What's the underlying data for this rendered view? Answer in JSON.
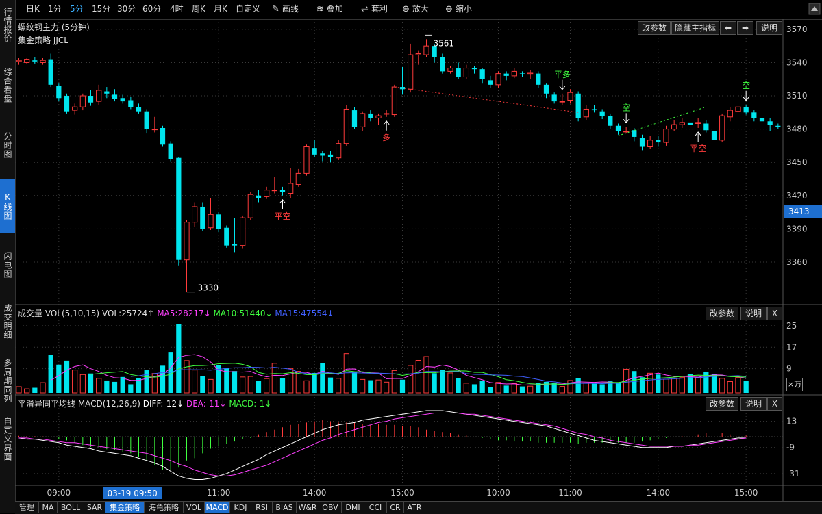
{
  "toolbar": {
    "periods": [
      "日K",
      "1分",
      "5分",
      "15分",
      "30分",
      "60分",
      "4时",
      "周K",
      "月K",
      "自定义"
    ],
    "active_period": "5分",
    "tools": [
      {
        "icon": "pencil-icon",
        "label": "画线"
      },
      {
        "icon": "layers-icon",
        "label": "叠加"
      },
      {
        "icon": "arbitrage-icon",
        "label": "套利"
      },
      {
        "icon": "zoom-in-icon",
        "label": "放大"
      },
      {
        "icon": "zoom-out-icon",
        "label": "缩小"
      }
    ]
  },
  "sidebar": {
    "items": [
      {
        "label": "行情报价",
        "active": false
      },
      {
        "label": "综合看盘",
        "active": false
      },
      {
        "label": "分时图",
        "active": false
      },
      {
        "label": "K线图",
        "active": true
      },
      {
        "label": "闪电图",
        "active": false
      },
      {
        "label": "成交明细",
        "active": false
      },
      {
        "label": "多周期同列",
        "active": false
      },
      {
        "label": "自定义界面",
        "active": false
      }
    ]
  },
  "main_chart": {
    "title": "螺纹钢主力 (5分钟)",
    "strategy": "集金策略 JJCL",
    "buttons": [
      "改参数",
      "隐藏主指标",
      "说明"
    ],
    "current_price": "3413",
    "high_label": "3561",
    "low_label": "3330",
    "signals": [
      {
        "text": "平空",
        "idx": 33,
        "dir": "up"
      },
      {
        "text": "多",
        "idx": 46,
        "dir": "up"
      },
      {
        "text": "平多",
        "idx": 68,
        "dir": "down"
      },
      {
        "text": "空",
        "idx": 76,
        "dir": "down"
      },
      {
        "text": "平空",
        "idx": 85,
        "dir": "up"
      },
      {
        "text": "空",
        "idx": 91,
        "dir": "down"
      }
    ]
  },
  "vol_panel": {
    "label": "成交量 VOL(5,10,15)",
    "vol": "VOL:25724↑",
    "ma5": "MA5:28217↓",
    "ma10": "MA10:51440↓",
    "ma15": "MA15:47554↓",
    "buttons": [
      "改参数",
      "说明",
      "X"
    ],
    "unit": "×万"
  },
  "macd_panel": {
    "label": "平滑异同平均线 MACD(12,26,9)",
    "diff": "DIFF:-12↓",
    "dea": "DEA:-11↓",
    "macd": "MACD:-1↓",
    "buttons": [
      "改参数",
      "说明",
      "X"
    ]
  },
  "time_axis": {
    "labels": [
      {
        "text": "09:00",
        "idx": 5
      },
      {
        "text": "11:00",
        "idx": 25
      },
      {
        "text": "14:00",
        "idx": 37
      },
      {
        "text": "15:00",
        "idx": 48
      },
      {
        "text": "10:00",
        "idx": 60
      },
      {
        "text": "11:00",
        "idx": 69
      },
      {
        "text": "14:00",
        "idx": 80
      },
      {
        "text": "15:00",
        "idx": 91
      }
    ],
    "cursor_label": "03-19 09:50",
    "cursor_idx": 13
  },
  "bottom_tabs": [
    "管理",
    "MA",
    "BOLL",
    "SAR",
    "集金策略",
    "海龟策略",
    "VOL",
    "MACD",
    "KDJ",
    "RSI",
    "BIAS",
    "W&R",
    "OBV",
    "DMI",
    "CCI",
    "CR",
    "ATR"
  ],
  "active_bottom_tabs": [
    "集金策略",
    "MACD"
  ],
  "colors": {
    "up": "#ff3b3b",
    "down": "#00e5ee",
    "accent": "#1e6fd0",
    "ma5": "#ff40ff",
    "ma10": "#40ff40",
    "ma15": "#4060ff",
    "diff": "#ffffff",
    "dea": "#ff40ff"
  },
  "chart_data": {
    "type": "candlestick",
    "price_axis": {
      "ticks": [
        3570,
        3540,
        3510,
        3480,
        3450,
        3420,
        3390,
        3360
      ],
      "range": [
        3326,
        3573
      ]
    },
    "vol_axis": {
      "ticks": [
        25,
        17,
        9
      ],
      "range": [
        0,
        27
      ]
    },
    "macd_axis": {
      "ticks": [
        13,
        -9,
        -31
      ],
      "range": [
        -38,
        22
      ]
    },
    "candles": [
      [
        3541,
        3542,
        3538,
        3544
      ],
      [
        3540,
        3543,
        3539,
        3544
      ],
      [
        3542,
        3541,
        3539,
        3545
      ],
      [
        3540,
        3542,
        3538,
        3544
      ],
      [
        3543,
        3520,
        3518,
        3548
      ],
      [
        3519,
        3508,
        3505,
        3521
      ],
      [
        3510,
        3496,
        3494,
        3512
      ],
      [
        3497,
        3500,
        3493,
        3503
      ],
      [
        3500,
        3510,
        3497,
        3512
      ],
      [
        3510,
        3504,
        3501,
        3515
      ],
      [
        3505,
        3515,
        3502,
        3520
      ],
      [
        3514,
        3512,
        3508,
        3518
      ],
      [
        3511,
        3507,
        3505,
        3516
      ],
      [
        3508,
        3505,
        3503,
        3511
      ],
      [
        3506,
        3500,
        3498,
        3509
      ],
      [
        3500,
        3496,
        3494,
        3503
      ],
      [
        3496,
        3480,
        3476,
        3498
      ],
      [
        3480,
        3480,
        3477,
        3491
      ],
      [
        3481,
        3466,
        3464,
        3483
      ],
      [
        3467,
        3453,
        3451,
        3469
      ],
      [
        3454,
        3362,
        3357,
        3455
      ],
      [
        3362,
        3396,
        3333,
        3398
      ],
      [
        3396,
        3410,
        3392,
        3414
      ],
      [
        3410,
        3390,
        3388,
        3414
      ],
      [
        3391,
        3403,
        3389,
        3418
      ],
      [
        3403,
        3390,
        3387,
        3405
      ],
      [
        3391,
        3375,
        3373,
        3393
      ],
      [
        3376,
        3375,
        3369,
        3400
      ],
      [
        3375,
        3400,
        3372,
        3402
      ],
      [
        3400,
        3421,
        3398,
        3423
      ],
      [
        3420,
        3418,
        3414,
        3425
      ],
      [
        3419,
        3425,
        3417,
        3428
      ],
      [
        3425,
        3425,
        3422,
        3437
      ],
      [
        3425,
        3423,
        3420,
        3428
      ],
      [
        3422,
        3431,
        3418,
        3445
      ],
      [
        3430,
        3440,
        3428,
        3444
      ],
      [
        3440,
        3464,
        3438,
        3466
      ],
      [
        3463,
        3457,
        3455,
        3470
      ],
      [
        3458,
        3456,
        3451,
        3460
      ],
      [
        3457,
        3455,
        3450,
        3460
      ],
      [
        3454,
        3467,
        3452,
        3470
      ],
      [
        3467,
        3498,
        3465,
        3502
      ],
      [
        3497,
        3482,
        3480,
        3500
      ],
      [
        3482,
        3494,
        3478,
        3496
      ],
      [
        3494,
        3490,
        3487,
        3497
      ],
      [
        3490,
        3492,
        3484,
        3494
      ],
      [
        3494,
        3494,
        3491,
        3497
      ],
      [
        3493,
        3518,
        3491,
        3520
      ],
      [
        3518,
        3516,
        3511,
        3536
      ],
      [
        3516,
        3547,
        3513,
        3557
      ],
      [
        3547,
        3548,
        3538,
        3551
      ],
      [
        3547,
        3555,
        3545,
        3561
      ],
      [
        3555,
        3545,
        3540,
        3557
      ],
      [
        3545,
        3532,
        3530,
        3548
      ],
      [
        3532,
        3535,
        3530,
        3537
      ],
      [
        3535,
        3527,
        3525,
        3540
      ],
      [
        3527,
        3535,
        3525,
        3538
      ],
      [
        3535,
        3534,
        3530,
        3537
      ],
      [
        3534,
        3525,
        3521,
        3535
      ],
      [
        3524,
        3520,
        3517,
        3528
      ],
      [
        3520,
        3530,
        3517,
        3532
      ],
      [
        3530,
        3528,
        3524,
        3532
      ],
      [
        3528,
        3532,
        3526,
        3535
      ],
      [
        3531,
        3530,
        3527,
        3532
      ],
      [
        3530,
        3531,
        3525,
        3533
      ],
      [
        3530,
        3520,
        3517,
        3532
      ],
      [
        3520,
        3512,
        3508,
        3521
      ],
      [
        3511,
        3505,
        3503,
        3513
      ],
      [
        3505,
        3505,
        3502,
        3512
      ],
      [
        3506,
        3513,
        3503,
        3516
      ],
      [
        3512,
        3490,
        3487,
        3514
      ],
      [
        3491,
        3498,
        3488,
        3502
      ],
      [
        3498,
        3497,
        3495,
        3502
      ],
      [
        3496,
        3492,
        3489,
        3498
      ],
      [
        3492,
        3483,
        3480,
        3494
      ],
      [
        3483,
        3478,
        3475,
        3485
      ],
      [
        3478,
        3478,
        3476,
        3482
      ],
      [
        3479,
        3473,
        3469,
        3481
      ],
      [
        3472,
        3464,
        3461,
        3475
      ],
      [
        3464,
        3470,
        3462,
        3474
      ],
      [
        3470,
        3468,
        3464,
        3474
      ],
      [
        3468,
        3480,
        3465,
        3483
      ],
      [
        3480,
        3484,
        3478,
        3488
      ],
      [
        3484,
        3486,
        3481,
        3490
      ],
      [
        3486,
        3484,
        3481,
        3488
      ],
      [
        3485,
        3486,
        3481,
        3490
      ],
      [
        3485,
        3479,
        3477,
        3488
      ],
      [
        3478,
        3470,
        3468,
        3481
      ],
      [
        3470,
        3492,
        3468,
        3494
      ],
      [
        3491,
        3497,
        3487,
        3500
      ],
      [
        3496,
        3500,
        3492,
        3503
      ],
      [
        3500,
        3495,
        3493,
        3502
      ],
      [
        3495,
        3490,
        3487,
        3497
      ],
      [
        3490,
        3487,
        3485,
        3492
      ],
      [
        3487,
        3484,
        3478,
        3490
      ],
      [
        3483,
        3482,
        3480,
        3485
      ]
    ],
    "volumes": [
      2.3,
      1.5,
      1.9,
      3.8,
      14.2,
      10.5,
      12.0,
      8.5,
      6.8,
      7.2,
      5.4,
      4.6,
      4.1,
      5.9,
      3.2,
      5.5,
      8.4,
      7.2,
      10.1,
      15.0,
      25.5,
      12.0,
      8.5,
      6.3,
      5.0,
      10.4,
      9.3,
      8.1,
      5.9,
      6.1,
      4.4,
      5.3,
      11.0,
      5.4,
      9.1,
      8.0,
      4.5,
      7.4,
      11.2,
      5.7,
      5.4,
      14.6,
      7.7,
      5.0,
      4.7,
      4.8,
      4.0,
      8.3,
      4.9,
      10.2,
      12.1,
      13.5,
      7.3,
      8.6,
      7.4,
      5.6,
      3.6,
      3.2,
      4.6,
      2.2,
      3.9,
      2.7,
      3.5,
      2.4,
      2.5,
      3.7,
      4.1,
      3.8,
      2.4,
      4.6,
      5.6,
      3.6,
      3.4,
      3.2,
      4.3,
      3.6,
      8.8,
      8.1,
      5.8,
      7.3,
      6.8,
      5.1,
      5.5,
      5.8,
      6.9,
      5.8,
      7.9,
      7.1,
      5.4,
      4.2,
      5.7,
      4.4
    ],
    "macd_bars": [
      0.8,
      0.6,
      0.4,
      0.2,
      -0.5,
      -1.8,
      -3.0,
      -5.0,
      -7.0,
      -8.5,
      -9.5,
      -10.5,
      -11,
      -12.5,
      -14,
      -17,
      -20,
      -24,
      -28,
      -28,
      -26,
      -20,
      -18,
      -14,
      -10,
      -8,
      -6,
      -4,
      -2,
      -1,
      2,
      4,
      6,
      8,
      10,
      11,
      12,
      13,
      14,
      13,
      12,
      12,
      12,
      11,
      10,
      11,
      10,
      10,
      9,
      9,
      8,
      6,
      5,
      4,
      3,
      2,
      1,
      -0.5,
      -1,
      -2,
      -3,
      -3,
      -4,
      -4,
      -4,
      -5,
      -5,
      -5,
      -5,
      -5,
      -6,
      -5,
      -5,
      -5,
      -5,
      -5,
      -5,
      -5,
      -4,
      -3,
      -2,
      -1,
      0,
      0.5,
      1,
      2,
      3,
      3,
      3,
      2,
      2,
      1
    ],
    "diff_line": [
      -1,
      -2,
      -2,
      -3,
      -4,
      -5,
      -7,
      -8,
      -9,
      -10,
      -12,
      -13,
      -14,
      -15,
      -16,
      -18,
      -20,
      -22,
      -25,
      -29,
      -33,
      -35,
      -36,
      -36,
      -35,
      -33,
      -31,
      -28,
      -25,
      -22,
      -19,
      -15,
      -12,
      -9,
      -6,
      -3,
      0,
      3,
      6,
      8,
      10,
      11,
      12,
      14,
      15,
      16,
      17,
      18,
      19,
      20,
      21,
      22,
      22,
      22,
      21,
      20,
      19,
      18,
      17,
      16,
      15,
      14,
      13,
      12,
      11,
      10,
      9,
      7,
      5,
      3,
      1,
      -1,
      -3,
      -4,
      -5,
      -6,
      -7,
      -8,
      -9,
      -9,
      -9,
      -9,
      -8,
      -8,
      -7,
      -6,
      -5,
      -4,
      -3,
      -2,
      -1,
      -1
    ],
    "dea_line": [
      -1,
      -1,
      -2,
      -2,
      -3,
      -4,
      -5,
      -5,
      -6,
      -7,
      -8,
      -9,
      -10,
      -11,
      -12,
      -13,
      -14,
      -16,
      -18,
      -20,
      -23,
      -25,
      -28,
      -30,
      -32,
      -33,
      -33,
      -32,
      -30,
      -28,
      -26,
      -24,
      -21,
      -18,
      -15,
      -12,
      -9,
      -6,
      -3,
      -1,
      2,
      4,
      6,
      8,
      10,
      12,
      13,
      15,
      16,
      17,
      18,
      19,
      20,
      20,
      20,
      20,
      19,
      19,
      18,
      17,
      16,
      15,
      14,
      13,
      12,
      11,
      10,
      9,
      7,
      5,
      3,
      2,
      0,
      -1,
      -3,
      -4,
      -5,
      -6,
      -7,
      -8,
      -8,
      -8,
      -8,
      -8,
      -7,
      -7,
      -6,
      -5,
      -4,
      -3,
      -2,
      -1
    ]
  }
}
